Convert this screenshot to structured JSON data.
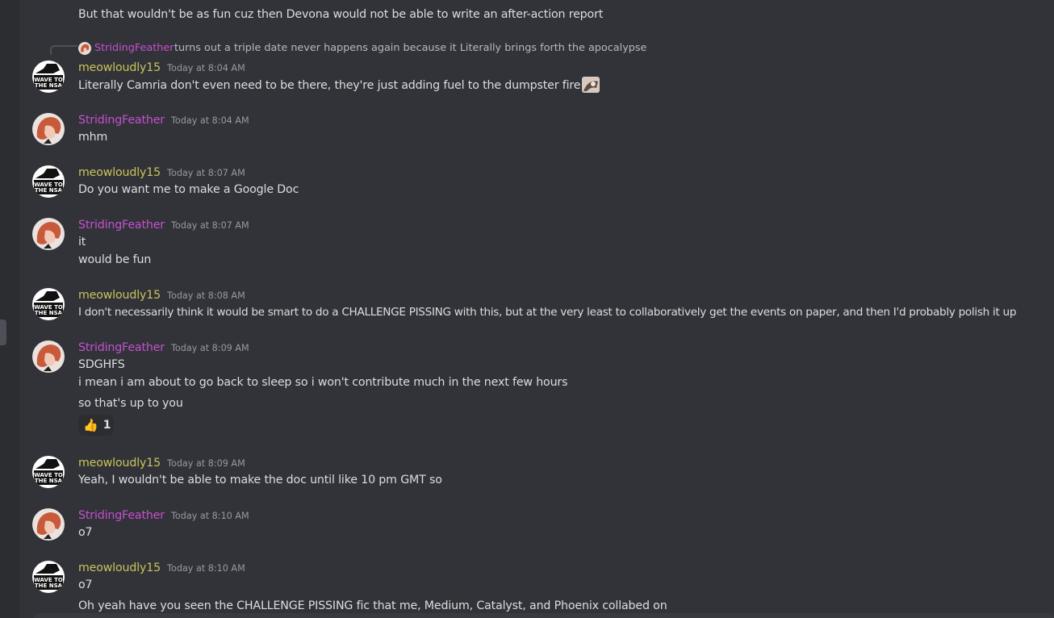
{
  "top_partial": {
    "text": "But that wouldn't be as fun cuz then Devona would not be able to write an after-action report"
  },
  "reply": {
    "author": "StridingFeather",
    "text": "turns out a triple date never happens again because it Literally brings forth the apocalypse"
  },
  "messages": [
    {
      "author": "meowloudly15",
      "time": "Today at 8:04 AM",
      "lines": [
        "Literally Camria don't even need to be there, they're just adding fuel to the dumpster fire"
      ]
    },
    {
      "author": "StridingFeather",
      "time": "Today at 8:04 AM",
      "lines": [
        "mhm"
      ]
    },
    {
      "author": "meowloudly15",
      "time": "Today at 8:07 AM",
      "lines": [
        "Do you want me to make a Google Doc"
      ]
    },
    {
      "author": "StridingFeather",
      "time": "Today at 8:07 AM",
      "lines": [
        "it",
        "would be fun"
      ]
    },
    {
      "author": "meowloudly15",
      "time": "Today at 8:08 AM",
      "lines": [
        "I don't necessarily think it would be smart to do a CHALLENGE PISSING with this, but at the very least to collaboratively get the events on paper, and then I'd probably polish it up"
      ]
    },
    {
      "author": "StridingFeather",
      "time": "Today at 8:09 AM",
      "lines": [
        "SDGHFS",
        "i mean i am about to go back to sleep so i won't contribute much in the next few hours",
        "so that's up to you"
      ]
    },
    {
      "author": "meowloudly15",
      "time": "Today at 8:09 AM",
      "lines": [
        "Yeah, I wouldn't be able to make the doc until like 10 pm GMT so"
      ]
    },
    {
      "author": "StridingFeather",
      "time": "Today at 8:10 AM",
      "lines": [
        "o7"
      ]
    },
    {
      "author": "meowloudly15",
      "time": "Today at 8:10 AM",
      "lines": [
        "o7",
        "Oh yeah have you seen the CHALLENGE PISSING fic that me, Medium, Catalyst, and Phoenix collabed on"
      ]
    }
  ],
  "reaction": {
    "emoji": "👍",
    "count": "1"
  },
  "avatar_text": {
    "meow": "WAVE TO THE NSA"
  },
  "icons": {
    "meow_avatar": "nsa-wave-avatar",
    "stride_avatar": "red-haired-character-avatar",
    "inline_emoji": "custom-emoji"
  },
  "colors": {
    "background": "#313338",
    "meow_name": "#c9c45b",
    "stride_name": "#c84fd1",
    "text": "#dbdee1",
    "muted": "#949ba4"
  }
}
